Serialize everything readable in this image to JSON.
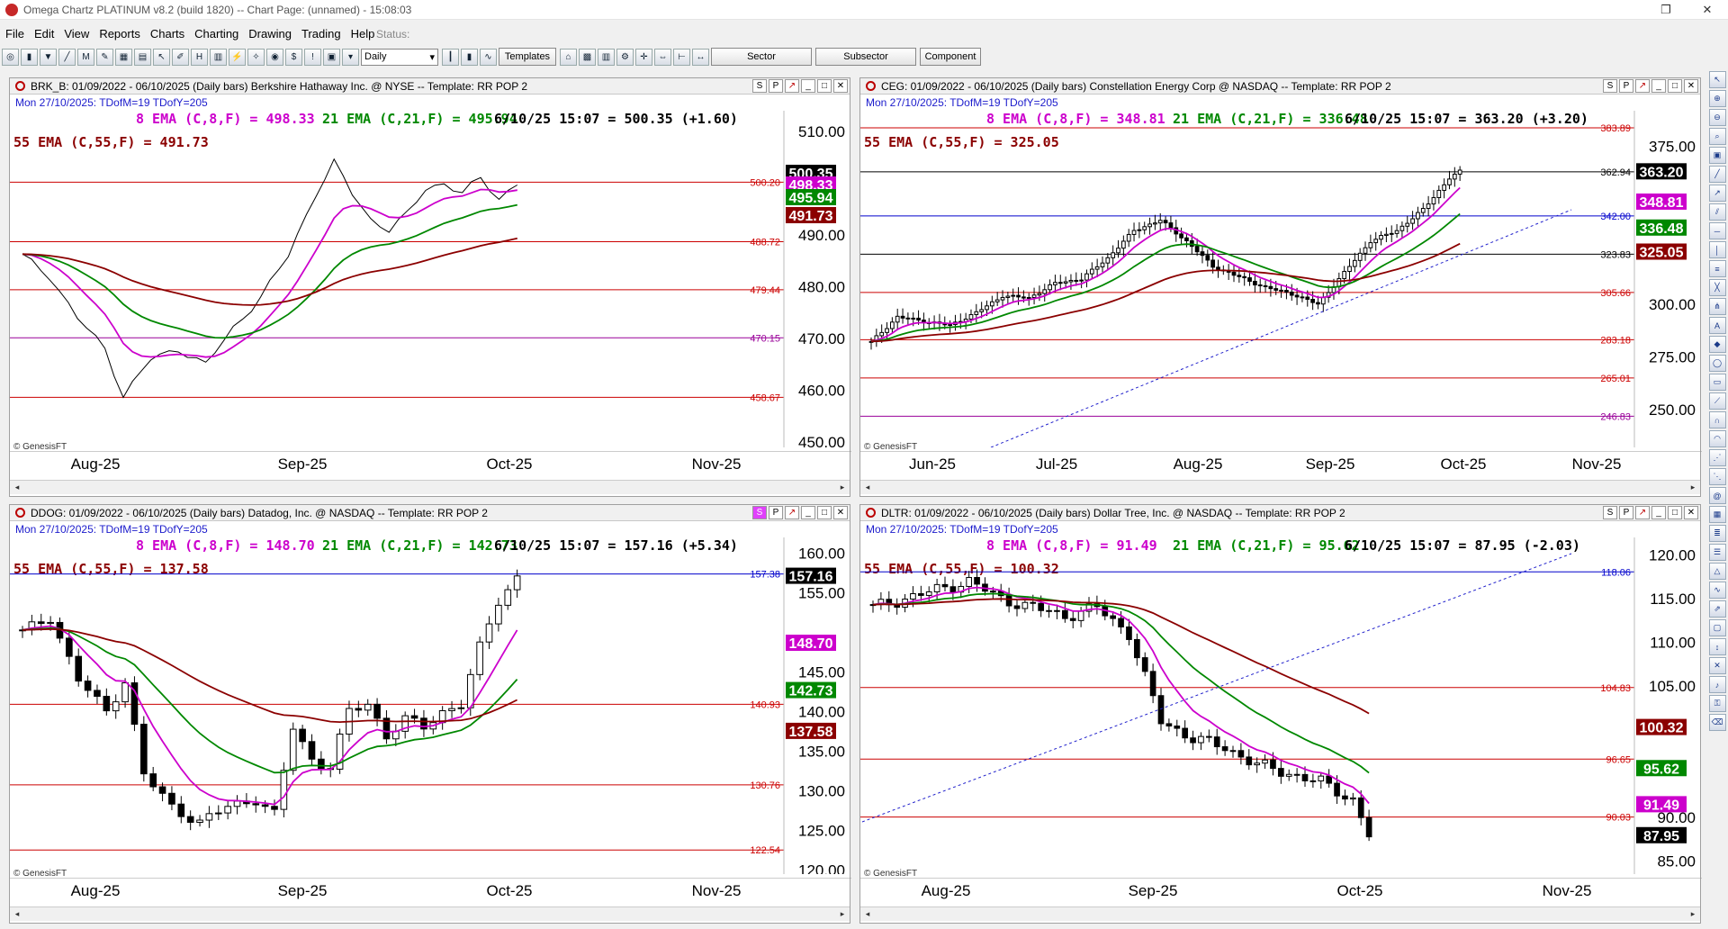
{
  "window": {
    "title": "Omega Chartz PLATINUM v8.2 (build 1820)  --  Chart Page: (unnamed) - 15:08:03",
    "restore_glyph": "❐",
    "close_glyph": "✕"
  },
  "menu": [
    "File",
    "Edit",
    "View",
    "Reports",
    "Charts",
    "Charting",
    "Drawing",
    "Trading",
    "Help"
  ],
  "status_label": "Status:",
  "toolbar": {
    "period_value": "Daily",
    "templates_label": "Templates",
    "sector_label": "Sector",
    "subsector_label": "Subsector",
    "component_label": "Component"
  },
  "header_buttons": {
    "s": "S",
    "p": "P",
    "x": "✕"
  },
  "watermark": "© GenesisFT",
  "panels": [
    {
      "id": "brk",
      "title": "BRK_B: 01/09/2022 - 06/10/2025  (Daily bars)  Berkshire Hathaway Inc. @ NYSE  --  Template: RR POP 2",
      "date_line": "Mon  27/10/2025:  TDofM=19  TDofY=205",
      "line1_a": "8 EMA (C,8,F) = 498.33",
      "line1_b": "21 EMA (C,21,F) = 495.94",
      "line1_c": "6/10/25 15:07 = 500.35 (+1.60)",
      "line2": "55 EMA (C,55,F) = 491.73",
      "price_ticks": [
        "510.00",
        "490.00",
        "480.00",
        "470.00",
        "460.00",
        "450.00"
      ],
      "hlines": [
        {
          "label": "500.20",
          "value": 500.2,
          "color": "#cc0000"
        },
        {
          "label": "488.72",
          "value": 488.72,
          "color": "#cc0000"
        },
        {
          "label": "479.44",
          "value": 479.44,
          "color": "#cc0000"
        },
        {
          "label": "470.15",
          "value": 470.15,
          "color": "#990099"
        },
        {
          "label": "458.67",
          "value": 458.67,
          "color": "#cc0000"
        }
      ],
      "badges": [
        {
          "text": "500.35",
          "bg": "#000000"
        },
        {
          "text": "498.33",
          "bg": "#cc00cc"
        },
        {
          "text": "495.94",
          "bg": "#008800"
        },
        {
          "text": "491.73",
          "bg": "#8b0000"
        }
      ],
      "x_labels": [
        "Aug-25",
        "Sep-25",
        "Oct-25",
        "Nov-25"
      ]
    },
    {
      "id": "ceg",
      "title": "CEG: 01/09/2022 - 06/10/2025  (Daily bars)  Constellation Energy Corp @ NASDAQ  --  Template: RR POP 2",
      "date_line": "Mon  27/10/2025:  TDofM=19  TDofY=205",
      "line1_a": "8 EMA (C,8,F) = 348.81",
      "line1_b": "21 EMA (C,21,F) = 336.48",
      "line1_c": "6/10/25 15:07 = 363.20 (+3.20)",
      "line2": "55 EMA (C,55,F) = 325.05",
      "price_ticks": [
        "375.00",
        "300.00",
        "275.00",
        "250.00"
      ],
      "hlines": [
        {
          "label": "383.89",
          "value": 383.89,
          "color": "#cc0000"
        },
        {
          "label": "362.94",
          "value": 362.94,
          "color": "#000000"
        },
        {
          "label": "342.00",
          "value": 342.0,
          "color": "#0000cc"
        },
        {
          "label": "323.83",
          "value": 323.83,
          "color": "#000000"
        },
        {
          "label": "305.66",
          "value": 305.66,
          "color": "#cc0000"
        },
        {
          "label": "283.18",
          "value": 283.18,
          "color": "#cc0000"
        },
        {
          "label": "265.01",
          "value": 265.01,
          "color": "#cc0000"
        },
        {
          "label": "246.83",
          "value": 246.83,
          "color": "#990099"
        }
      ],
      "badges": [
        {
          "text": "363.20",
          "bg": "#000000"
        },
        {
          "text": "348.81",
          "bg": "#cc00cc"
        },
        {
          "text": "336.48",
          "bg": "#008800"
        },
        {
          "text": "325.05",
          "bg": "#8b0000"
        }
      ],
      "x_labels": [
        "Jun-25",
        "Jul-25",
        "Aug-25",
        "Sep-25",
        "Oct-25",
        "Nov-25"
      ]
    },
    {
      "id": "ddog",
      "title": "DDOG: 01/09/2022 - 06/10/2025  (Daily bars)  Datadog, Inc. @ NASDAQ  --  Template: RR POP 2",
      "date_line": "Mon  27/10/2025:  TDofM=19  TDofY=205",
      "line1_a": "8 EMA (C,8,F) = 148.70",
      "line1_b": "21 EMA (C,21,F) = 142.73",
      "line1_c": "6/10/25 15:07 = 157.16 (+5.34)",
      "line2": "55 EMA (C,55,F) = 137.58",
      "price_ticks": [
        "160.00",
        "155.00",
        "145.00",
        "140.00",
        "135.00",
        "130.00",
        "125.00",
        "120.00"
      ],
      "hlines": [
        {
          "label": "157.38",
          "value": 157.38,
          "color": "#0000cc"
        },
        {
          "label": "140.93",
          "value": 140.93,
          "color": "#cc0000"
        },
        {
          "label": "130.76",
          "value": 130.76,
          "color": "#cc0000"
        },
        {
          "label": "122.54",
          "value": 122.54,
          "color": "#cc0000"
        }
      ],
      "badges": [
        {
          "text": "157.16",
          "bg": "#000000"
        },
        {
          "text": "148.70",
          "bg": "#cc00cc"
        },
        {
          "text": "142.73",
          "bg": "#008800"
        },
        {
          "text": "137.58",
          "bg": "#8b0000"
        }
      ],
      "x_labels": [
        "Aug-25",
        "Sep-25",
        "Oct-25",
        "Nov-25"
      ]
    },
    {
      "id": "dltr",
      "title": "DLTR: 01/09/2022 - 06/10/2025  (Daily bars)  Dollar Tree, Inc. @ NASDAQ  --  Template: RR POP 2",
      "date_line": "Mon  27/10/2025:  TDofM=19  TDofY=205",
      "line1_a": "8 EMA (C,8,F) = 91.49",
      "line1_b": "21 EMA (C,21,F) = 95.62",
      "line1_c": "6/10/25 15:07 = 87.95 (-2.03)",
      "line2": "55 EMA (C,55,F) = 100.32",
      "price_ticks": [
        "120.00",
        "115.00",
        "110.00",
        "105.00",
        "90.00",
        "85.00"
      ],
      "hlines": [
        {
          "label": "118.06",
          "value": 118.06,
          "color": "#0000cc"
        },
        {
          "label": "104.83",
          "value": 104.83,
          "color": "#cc0000"
        },
        {
          "label": "96.65",
          "value": 96.65,
          "color": "#cc0000"
        },
        {
          "label": "90.03",
          "value": 90.03,
          "color": "#cc0000"
        }
      ],
      "badges": [
        {
          "text": "100.32",
          "bg": "#8b0000"
        },
        {
          "text": "95.62",
          "bg": "#008800"
        },
        {
          "text": "91.49",
          "bg": "#cc00cc"
        },
        {
          "text": "87.95",
          "bg": "#000000"
        }
      ],
      "x_labels": [
        "Aug-25",
        "Sep-25",
        "Oct-25",
        "Nov-25"
      ]
    }
  ]
}
